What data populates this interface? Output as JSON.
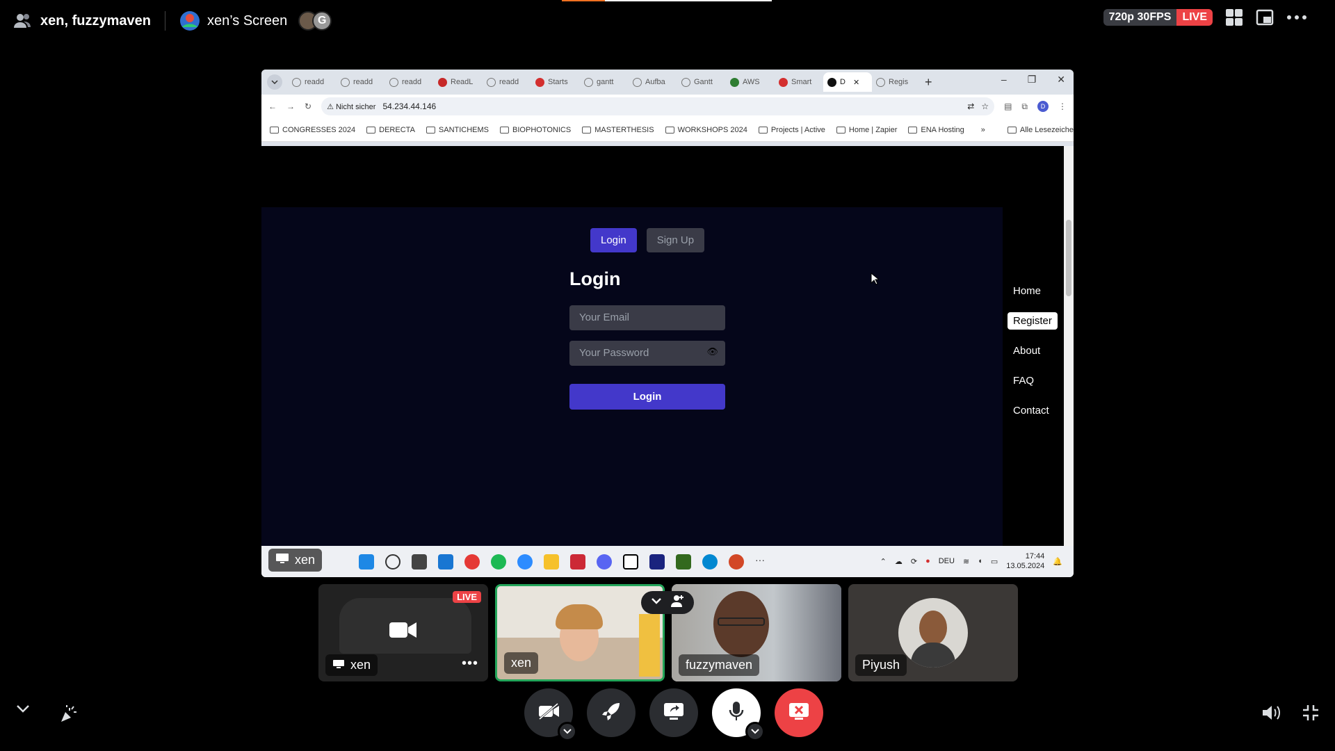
{
  "topbar": {
    "call_name": "xen, fuzzymaven",
    "screen_title": "xen’s Screen",
    "quality": "720p 30FPS",
    "live": "LIVE"
  },
  "browser": {
    "tabs": [
      {
        "label": "readd",
        "icon": "gray-globe"
      },
      {
        "label": "readd",
        "icon": "gray-globe"
      },
      {
        "label": "readd",
        "icon": "gray-globe"
      },
      {
        "label": "ReadL",
        "icon": "pdf"
      },
      {
        "label": "readd",
        "icon": "gray-globe"
      },
      {
        "label": "Starts",
        "icon": "red"
      },
      {
        "label": "gantt",
        "icon": "gray-globe"
      },
      {
        "label": "Aufba",
        "icon": "gray-globe"
      },
      {
        "label": "Gantt",
        "icon": "gray-globe"
      },
      {
        "label": "AWS",
        "icon": "green"
      },
      {
        "label": "Smart",
        "icon": "red"
      },
      {
        "label": "D",
        "icon": "black",
        "active": true
      },
      {
        "label": "Regis",
        "icon": "gray-globe"
      }
    ],
    "security_label": "Nicht sicher",
    "url": "54.234.44.146",
    "profile_initial": "D",
    "bookmarks": [
      "CONGRESSES 2024",
      "DERECTA",
      "SANTICHEMS",
      "BIOPHOTONICS",
      "MASTERTHESIS",
      "WORKSHOPS 2024",
      "Projects | Active",
      "Home | Zapier",
      "ENA Hosting"
    ],
    "all_bookmarks": "Alle Lesezeichen"
  },
  "page": {
    "tab_login": "Login",
    "tab_signup": "Sign Up",
    "form_title": "Login",
    "email_placeholder": "Your Email",
    "password_placeholder": "Your Password",
    "submit": "Login",
    "nav": [
      "Home",
      "Register",
      "About",
      "FAQ",
      "Contact"
    ],
    "nav_active": "Register"
  },
  "taskbar": {
    "sharer": "xen",
    "language": "DEU",
    "time": "17:44",
    "date": "13.05.2024"
  },
  "participants": [
    {
      "name": "xen",
      "type": "stream",
      "live": "LIVE"
    },
    {
      "name": "xen",
      "type": "camera",
      "speaking": true
    },
    {
      "name": "fuzzymaven",
      "type": "camera"
    },
    {
      "name": "Piyush",
      "type": "avatar"
    }
  ],
  "colors": {
    "accent": "#4338ca",
    "live_red": "#ed4245",
    "speaking_green": "#23a55a"
  }
}
